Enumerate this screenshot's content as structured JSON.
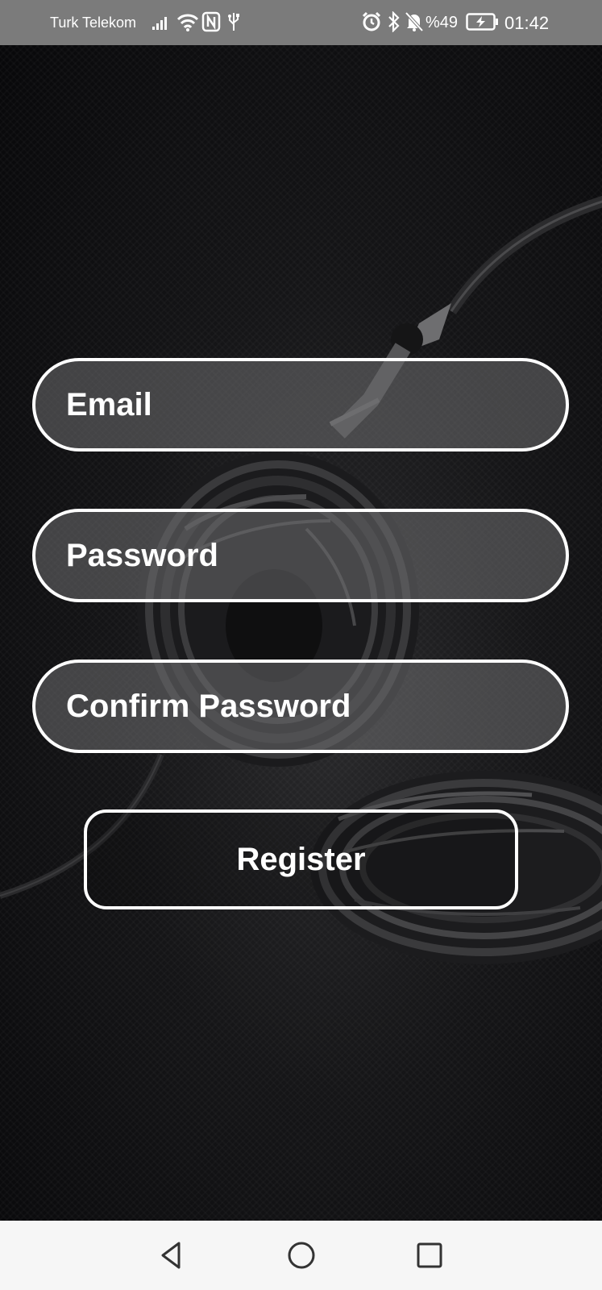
{
  "status_bar": {
    "carrier": "Turk Telekom",
    "icons": [
      "signal-icon",
      "wifi-icon",
      "nfc-icon",
      "usb-icon",
      "alarm-icon",
      "bluetooth-icon",
      "mute-icon",
      "battery-icon"
    ],
    "battery_percent": "%49",
    "time": "01:42"
  },
  "form": {
    "email_placeholder": "Email",
    "password_placeholder": "Password",
    "confirm_password_placeholder": "Confirm Password",
    "register_label": "Register"
  },
  "nav_bar": {
    "buttons": [
      "back-icon",
      "home-icon",
      "recents-icon"
    ]
  },
  "colors": {
    "status_bar_bg": "#7b7b7b",
    "field_border": "#ffffff",
    "nav_bar_bg": "#f6f6f6"
  }
}
